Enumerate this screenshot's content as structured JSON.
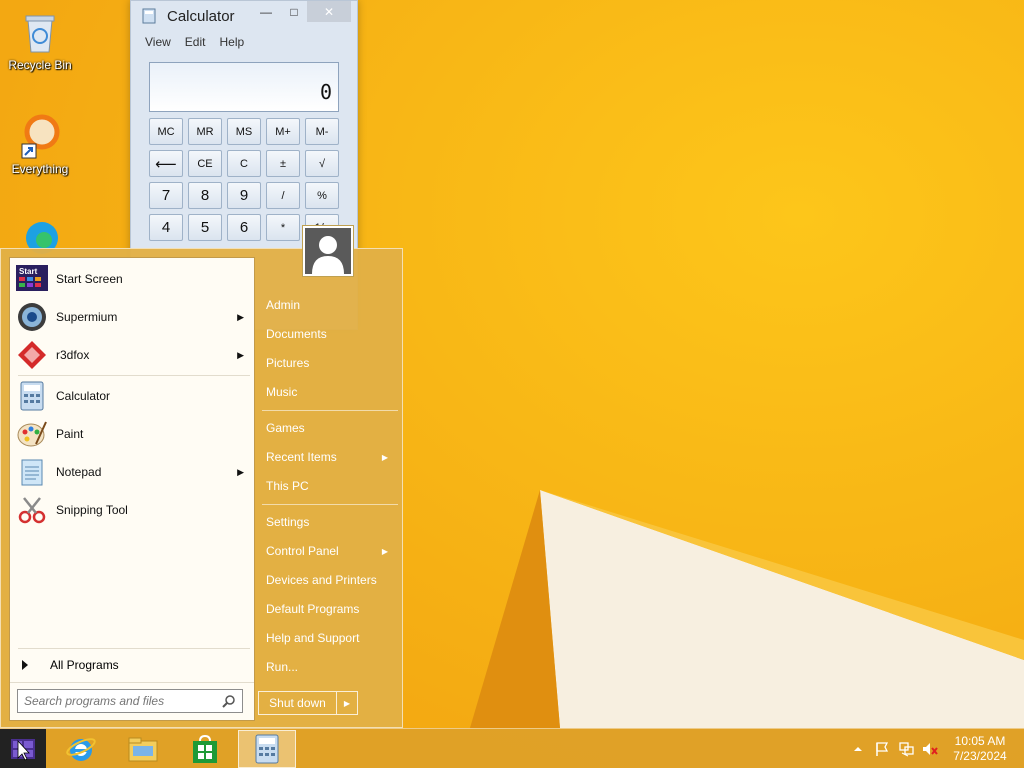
{
  "desktop": {
    "icons": [
      {
        "label": "Recycle Bin",
        "icon": "recycle-bin-icon"
      },
      {
        "label": "Everything",
        "icon": "everything-icon"
      },
      {
        "label": "",
        "icon": "edge-icon"
      }
    ]
  },
  "calculator": {
    "title": "Calculator",
    "menu": [
      "View",
      "Edit",
      "Help"
    ],
    "display": "0",
    "keys_row1": [
      "MC",
      "MR",
      "MS",
      "M+",
      "M-"
    ],
    "keys_row2": [
      "⟵",
      "CE",
      "C",
      "±",
      "√"
    ],
    "keys_row3": [
      "7",
      "8",
      "9",
      "/",
      "%"
    ],
    "keys_row4": [
      "4",
      "5",
      "6",
      "*",
      "1/x"
    ]
  },
  "start_menu": {
    "programs": [
      {
        "label": "Start Screen",
        "icon": "start-screen-icon",
        "has_submenu": false
      },
      {
        "label": "Supermium",
        "icon": "supermium-icon",
        "has_submenu": true
      },
      {
        "label": "r3dfox",
        "icon": "r3dfox-icon",
        "has_submenu": true
      },
      {
        "label": "Calculator",
        "icon": "calculator-icon",
        "has_submenu": false
      },
      {
        "label": "Paint",
        "icon": "paint-icon",
        "has_submenu": false
      },
      {
        "label": "Notepad",
        "icon": "notepad-icon",
        "has_submenu": true
      },
      {
        "label": "Snipping Tool",
        "icon": "snipping-tool-icon",
        "has_submenu": false
      }
    ],
    "all_programs": "All Programs",
    "search_placeholder": "Search programs and files",
    "right_items": [
      {
        "label": "Admin",
        "has_submenu": false
      },
      {
        "label": "Documents",
        "has_submenu": false
      },
      {
        "label": "Pictures",
        "has_submenu": false
      },
      {
        "label": "Music",
        "has_submenu": false
      },
      {
        "label": "Games",
        "has_submenu": false
      },
      {
        "label": "Recent Items",
        "has_submenu": true
      },
      {
        "label": "This PC",
        "has_submenu": false
      },
      {
        "label": "Settings",
        "has_submenu": false
      },
      {
        "label": "Control Panel",
        "has_submenu": true
      },
      {
        "label": "Devices and Printers",
        "has_submenu": false
      },
      {
        "label": "Default Programs",
        "has_submenu": false
      },
      {
        "label": "Help and Support",
        "has_submenu": false
      },
      {
        "label": "Run...",
        "has_submenu": false
      }
    ],
    "shutdown_label": "Shut down"
  },
  "taskbar": {
    "pinned": [
      "internet-explorer-icon",
      "file-explorer-icon",
      "store-icon",
      "calculator-icon"
    ],
    "active_app": "Calculator",
    "tray": [
      "show-hidden-icons-icon",
      "action-center-flag-icon",
      "network-icon",
      "volume-muted-icon"
    ],
    "time": "10:05 AM",
    "date": "7/23/2024"
  },
  "colors": {
    "wallpaper": "#f5b316",
    "startmenu": "#e2b046",
    "taskbar": "#dea028"
  }
}
